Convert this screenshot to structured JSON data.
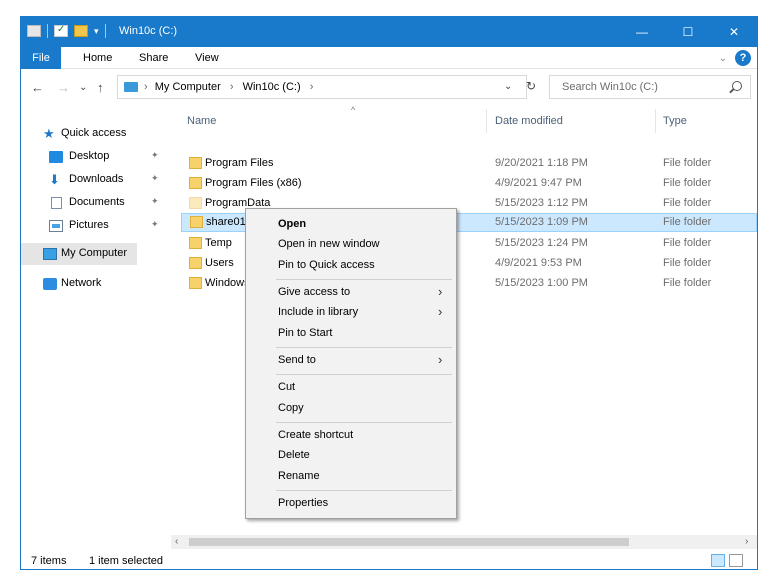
{
  "window": {
    "title": "Win10c (C:)",
    "accent_color": "#1979ca",
    "controls": {
      "minimize": "—",
      "maximize": "☐",
      "close": "✕"
    }
  },
  "quick_access_toolbar": {
    "icons": [
      "drive-icon",
      "checkbox-icon",
      "folder-icon",
      "dropdown-icon"
    ]
  },
  "ribbon": {
    "tabs": [
      "File",
      "Home",
      "Share",
      "View"
    ],
    "expand_chevron": "⌄",
    "help_label": "?"
  },
  "navigation": {
    "back": "←",
    "forward": "→",
    "recent": "⌄",
    "up": "↑",
    "breadcrumbs": [
      "My Computer",
      "Win10c (C:)"
    ],
    "crumb_separator": "›",
    "refresh": "↻",
    "search_placeholder": "Search Win10c (C:)"
  },
  "sidebar": {
    "quick_access_label": "Quick access",
    "items": [
      {
        "label": "Desktop",
        "pinned": true,
        "icon": "desktop-icon"
      },
      {
        "label": "Downloads",
        "pinned": true,
        "icon": "downloads-icon"
      },
      {
        "label": "Documents",
        "pinned": true,
        "icon": "documents-icon"
      },
      {
        "label": "Pictures",
        "pinned": true,
        "icon": "pictures-icon"
      }
    ],
    "my_computer_label": "My Computer",
    "network_label": "Network",
    "pin_glyph": "✦"
  },
  "columns": {
    "name": "Name",
    "date_modified": "Date modified",
    "type": "Type",
    "sort_indicator": "^"
  },
  "files": [
    {
      "name": "Program Files",
      "date": "9/20/2021 1:18 PM",
      "type": "File folder"
    },
    {
      "name": "Program Files (x86)",
      "date": "4/9/2021 9:47 PM",
      "type": "File folder"
    },
    {
      "name": "ProgramData",
      "date": "5/15/2023 1:12 PM",
      "type": "File folder"
    },
    {
      "name": "share01",
      "date": "5/15/2023 1:09 PM",
      "type": "File folder"
    },
    {
      "name": "Temp",
      "date": "5/15/2023 1:24 PM",
      "type": "File folder"
    },
    {
      "name": "Users",
      "date": "4/9/2021 9:53 PM",
      "type": "File folder"
    },
    {
      "name": "Windows",
      "date": "5/15/2023 1:00 PM",
      "type": "File folder"
    }
  ],
  "selected_file": "share01",
  "context_menu": {
    "open": "Open",
    "open_new_window": "Open in new window",
    "pin_quick_access": "Pin to Quick access",
    "give_access": "Give access to",
    "include_library": "Include in library",
    "pin_start": "Pin to Start",
    "send_to": "Send to",
    "cut": "Cut",
    "copy": "Copy",
    "create_shortcut": "Create shortcut",
    "delete": "Delete",
    "rename": "Rename",
    "properties": "Properties",
    "submenu_arrow": "›"
  },
  "status": {
    "items_count": "7 items",
    "selection": "1 item selected"
  },
  "scrollbar": {
    "left_arrow": "‹",
    "right_arrow": "›"
  }
}
